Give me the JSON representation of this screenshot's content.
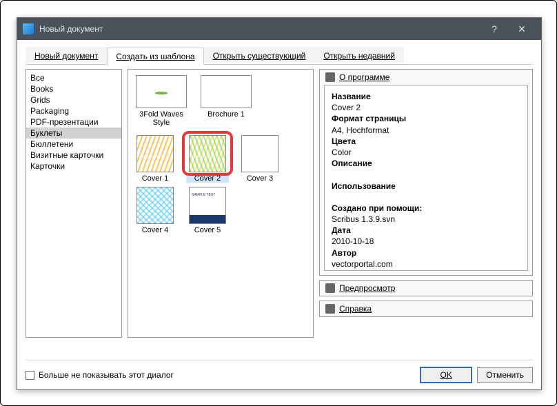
{
  "window": {
    "title": "Новый документ"
  },
  "tabs": [
    {
      "label": "Новый документ"
    },
    {
      "label": "Создать из шаблона"
    },
    {
      "label": "Открыть существующий"
    },
    {
      "label": "Открыть недавний"
    }
  ],
  "categories": [
    "Все",
    "Books",
    "Grids",
    "Packaging",
    "PDF-презентации",
    "Буклеты",
    "Бюллетени",
    "Визитные карточки",
    "Карточки"
  ],
  "templates": [
    {
      "label": "3Fold Waves Style"
    },
    {
      "label": "Brochure 1"
    },
    {
      "label": "Cover 1"
    },
    {
      "label": "Cover 2"
    },
    {
      "label": "Cover 3"
    },
    {
      "label": "Cover 4"
    },
    {
      "label": "Cover 5"
    }
  ],
  "sections": {
    "about": "О программе",
    "preview": "Предпросмотр",
    "help": "Справка"
  },
  "about": {
    "name_lbl": "Название",
    "name": "Cover 2",
    "page_lbl": "Формат страницы",
    "page": "A4, Hochformat",
    "colors_lbl": "Цвета",
    "colors": "Color",
    "desc_lbl": "Описание",
    "usage_lbl": "Использование",
    "made_lbl": "Создано при помощи:",
    "made": "Scribus 1.3.9.svn",
    "date_lbl": "Дата",
    "date": "2010-10-18",
    "author_lbl": "Автор",
    "author": "vectorportal.com"
  },
  "footer": {
    "checkbox": "Больше не показывать этот диалог",
    "ok": "OK",
    "cancel": "Отменить"
  }
}
